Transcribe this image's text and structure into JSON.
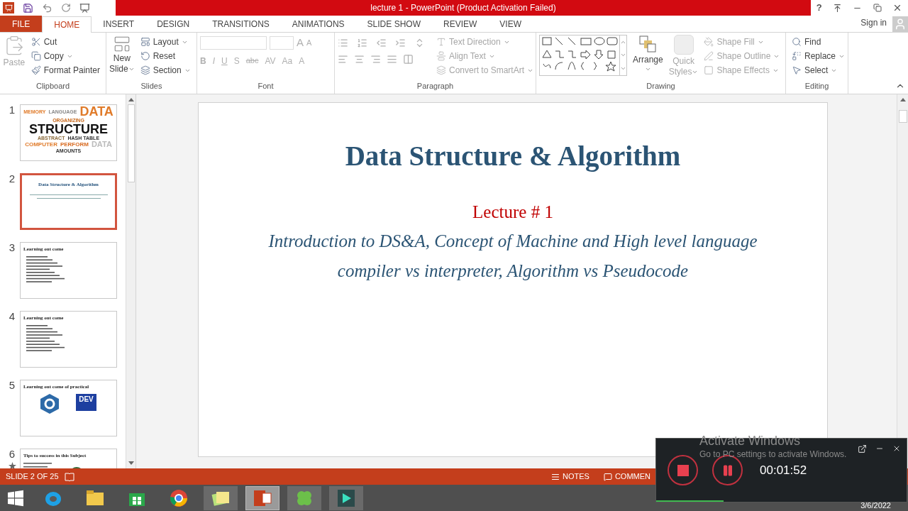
{
  "title_bar": {
    "title": "lecture 1 -  PowerPoint (Product Activation Failed)",
    "help": "?"
  },
  "tabs": [
    {
      "label": "FILE",
      "kind": "file",
      "selected": false
    },
    {
      "label": "HOME",
      "kind": "tab",
      "selected": true
    },
    {
      "label": "INSERT",
      "kind": "tab",
      "selected": false
    },
    {
      "label": "DESIGN",
      "kind": "tab",
      "selected": false
    },
    {
      "label": "TRANSITIONS",
      "kind": "tab",
      "selected": false
    },
    {
      "label": "ANIMATIONS",
      "kind": "tab",
      "selected": false
    },
    {
      "label": "SLIDE SHOW",
      "kind": "tab",
      "selected": false
    },
    {
      "label": "REVIEW",
      "kind": "tab",
      "selected": false
    },
    {
      "label": "VIEW",
      "kind": "tab",
      "selected": false
    }
  ],
  "sign_in": "Sign in",
  "ribbon": {
    "clipboard": {
      "label": "Clipboard",
      "paste": {
        "label": "Paste",
        "disabled": true
      },
      "items": [
        {
          "label": "Cut",
          "disabled": false
        },
        {
          "label": "Copy",
          "disabled": false
        },
        {
          "label": "Format Painter",
          "disabled": false
        }
      ]
    },
    "slides": {
      "label": "Slides",
      "new_slide": [
        "New",
        "Slide"
      ],
      "items": [
        {
          "label": "Layout",
          "disabled": false
        },
        {
          "label": "Reset",
          "disabled": false
        },
        {
          "label": "Section",
          "disabled": false
        }
      ]
    },
    "font": {
      "label": "Font",
      "format_buttons": [
        "B",
        "I",
        "U",
        "S",
        "abc",
        "AV",
        "Aa",
        "A"
      ],
      "size_buttons": [
        "A",
        "A"
      ],
      "disabled": true
    },
    "paragraph": {
      "label": "Paragraph",
      "items": [
        {
          "label": "Text Direction",
          "disabled": true
        },
        {
          "label": "Align Text",
          "disabled": true
        },
        {
          "label": "Convert to SmartArt",
          "disabled": true
        }
      ]
    },
    "drawing": {
      "label": "Drawing",
      "arrange": "Arrange",
      "quick_styles": [
        "Quick",
        "Styles"
      ],
      "items": [
        {
          "label": "Shape Fill",
          "disabled": true
        },
        {
          "label": "Shape Outline",
          "disabled": true
        },
        {
          "label": "Shape Effects",
          "disabled": true
        }
      ]
    },
    "editing": {
      "label": "Editing",
      "items": [
        {
          "label": "Find",
          "disabled": false
        },
        {
          "label": "Replace",
          "disabled": false
        },
        {
          "label": "Select",
          "disabled": false
        }
      ]
    }
  },
  "thumbnails": [
    {
      "number": "1",
      "kind": "wordcloud",
      "selected": false,
      "animated": false,
      "words": [
        "MEMORY",
        "LANGUAGE",
        "DATA",
        "ORGANIZING",
        "STRUCTURE",
        "ABSTRACT",
        "HASH TABLE",
        "COMPUTER",
        "PERFORM",
        "DATA",
        "AMOUNTS"
      ]
    },
    {
      "number": "2",
      "kind": "title",
      "selected": true,
      "animated": false,
      "title": "Data Structure & Algorithm"
    },
    {
      "number": "3",
      "kind": "bullets",
      "selected": false,
      "animated": false,
      "title": "Learning out come"
    },
    {
      "number": "4",
      "kind": "bullets",
      "selected": false,
      "animated": false,
      "title": "Learning out come"
    },
    {
      "number": "5",
      "kind": "logos",
      "selected": false,
      "animated": false,
      "title": "Learning out come of practical",
      "logo_text": "DEV"
    },
    {
      "number": "6",
      "kind": "figures",
      "selected": false,
      "animated": true,
      "title": "Tips to success in this Subject"
    }
  ],
  "slide": {
    "title": "Data Structure & Algorithm",
    "lecture": "Lecture # 1",
    "subtitle": [
      "Introduction to DS&A, Concept of Machine and High level language",
      "compiler vs interpreter, Algorithm vs Pseudocode"
    ]
  },
  "status_bar": {
    "position": "SLIDE 2 OF 25",
    "notes": "NOTES",
    "comments": "COMMEN"
  },
  "taskbar": [
    {
      "kind": "ie",
      "selected": false
    },
    {
      "kind": "explorer",
      "selected": false
    },
    {
      "kind": "store",
      "selected": false
    },
    {
      "kind": "chrome",
      "selected": false
    },
    {
      "kind": "notes",
      "selected": false
    },
    {
      "kind": "powerpoint",
      "selected": true
    },
    {
      "kind": "clover",
      "selected": false
    },
    {
      "kind": "editor",
      "selected": false
    }
  ],
  "date": "3/6/2022",
  "recorder": {
    "time": "00:01:52"
  },
  "activation": {
    "title": "Activate Windows",
    "message": "Go to PC settings to activate Windows."
  }
}
